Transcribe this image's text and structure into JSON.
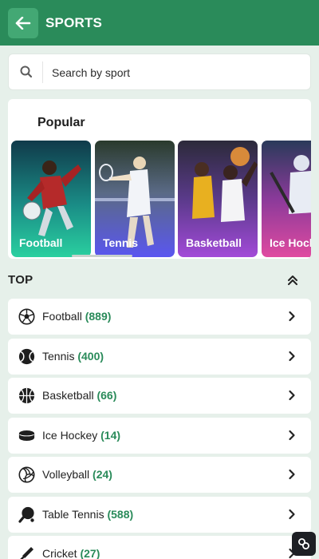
{
  "header": {
    "title": "SPORTS"
  },
  "search": {
    "placeholder": "Search by sport"
  },
  "popular": {
    "title": "Popular",
    "cards": [
      {
        "label": "Football"
      },
      {
        "label": "Tennis"
      },
      {
        "label": "Basketball"
      },
      {
        "label": "Ice Hock"
      }
    ]
  },
  "top": {
    "title": "TOP",
    "items": [
      {
        "name": "Football",
        "count": "(889)",
        "icon": "soccer-ball-icon"
      },
      {
        "name": "Tennis",
        "count": "(400)",
        "icon": "tennis-ball-icon"
      },
      {
        "name": "Basketball",
        "count": "(66)",
        "icon": "basketball-icon"
      },
      {
        "name": "Ice Hockey",
        "count": "(14)",
        "icon": "hockey-puck-icon"
      },
      {
        "name": "Volleyball",
        "count": "(24)",
        "icon": "volleyball-icon"
      },
      {
        "name": "Table Tennis",
        "count": "(588)",
        "icon": "table-tennis-paddle-icon"
      },
      {
        "name": "Cricket",
        "count": "(27)",
        "icon": "cricket-bat-icon"
      }
    ]
  },
  "colors": {
    "header": "#2a8b5a",
    "accent": "#2a8b5a",
    "background": "#e6f0ea"
  }
}
